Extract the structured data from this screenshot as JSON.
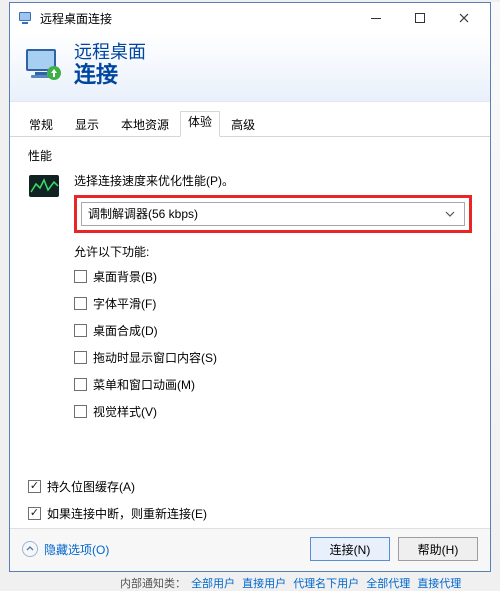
{
  "titlebar": {
    "title": "远程桌面连接"
  },
  "header": {
    "line1": "远程桌面",
    "line2": "连接"
  },
  "tabs": {
    "general": "常规",
    "display": "显示",
    "local": "本地资源",
    "experience": "体验",
    "advanced": "高级"
  },
  "group": {
    "performance": "性能"
  },
  "performance": {
    "prompt": "选择连接速度来优化性能(P)。",
    "combo_value": "调制解调器(56 kbps)",
    "allow_label": "允许以下功能:",
    "items": {
      "bg": "桌面背景(B)",
      "font": "字体平滑(F)",
      "compose": "桌面合成(D)",
      "dragshow": "拖动时显示窗口内容(S)",
      "anim": "菜单和窗口动画(M)",
      "visual": "视觉样式(V)"
    }
  },
  "bottom": {
    "bitmap": "持久位图缓存(A)",
    "reconnect": "如果连接中断，则重新连接(E)"
  },
  "footer": {
    "hide": "隐藏选项(O)",
    "connect": "连接(N)",
    "help": "帮助(H)"
  },
  "status": {
    "label": "内部通知类：",
    "a": "全部用户",
    "b": "直接用户",
    "c": "代理名下用户",
    "d": "全部代理",
    "e": "直接代理"
  }
}
